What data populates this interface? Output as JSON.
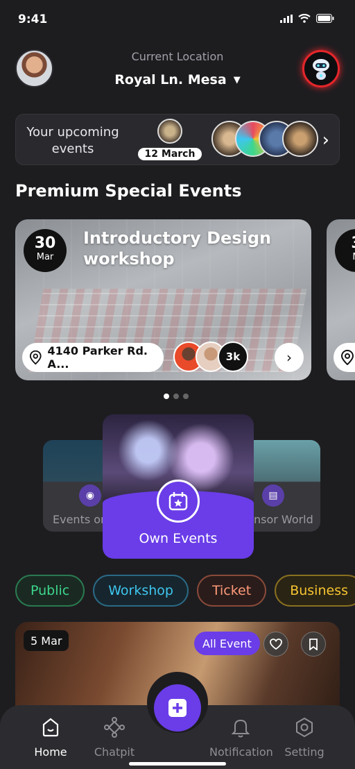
{
  "status_bar": {
    "time": "9:41"
  },
  "header": {
    "location_label": "Current Location",
    "location_value": "Royal Ln. Mesa"
  },
  "upcoming": {
    "label": "Your upcoming events",
    "date": "12 March"
  },
  "premium": {
    "title": "Premium Special Events",
    "card": {
      "day": "30",
      "month": "Mar",
      "title": "Introductory Design workshop",
      "address": "4140 Parker Rd. A...",
      "attendee_count": "3k"
    },
    "peek_day": "3",
    "peek_month": "M"
  },
  "categories": {
    "left_label": "Events on",
    "center_label": "Own Events",
    "right_label": "nsor World"
  },
  "tags": [
    "Public",
    "Workshop",
    "Ticket",
    "Business"
  ],
  "bottom_card": {
    "date": "5 Mar",
    "badge": "All Event"
  },
  "nav": {
    "home": "Home",
    "chatpit": "Chatpit",
    "notification": "Notification",
    "setting": "Setting"
  },
  "colors": {
    "accent": "#6a3de8",
    "background": "#1d1d20",
    "bot_ring": "#e5262b"
  }
}
